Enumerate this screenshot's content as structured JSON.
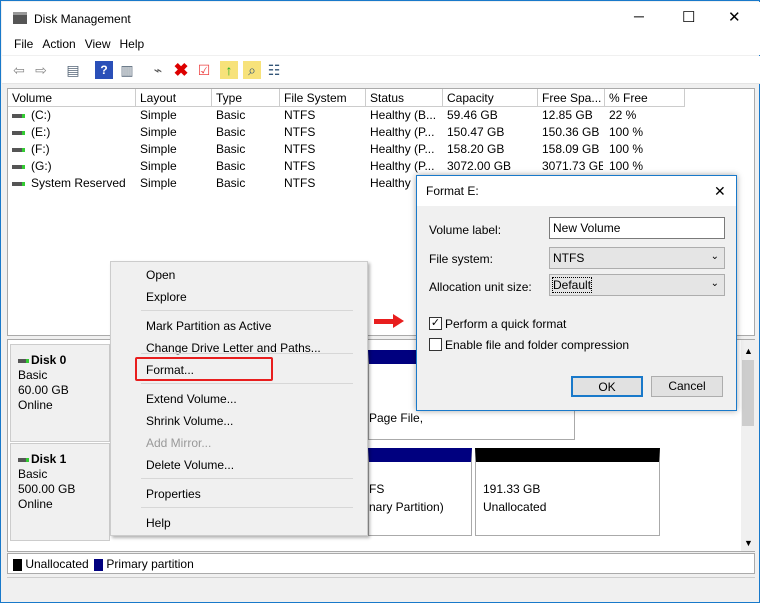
{
  "window": {
    "title": "Disk Management",
    "minimize": "─",
    "maximize": "☐",
    "close": "✕"
  },
  "menu": [
    "File",
    "Action",
    "View",
    "Help"
  ],
  "toolbar": [
    "back-icon",
    "forward-icon",
    "show-hide-console-tree-icon",
    "help-icon",
    "show-action-pane-icon",
    "connect-drive-icon",
    "delete-icon",
    "properties-icon",
    "up-folder-icon",
    "search-folder-icon",
    "checklist-icon"
  ],
  "columns": [
    "Volume",
    "Layout",
    "Type",
    "File System",
    "Status",
    "Capacity",
    "Free Spa...",
    "% Free"
  ],
  "volumes": [
    [
      "(C:)",
      "Simple",
      "Basic",
      "NTFS",
      "Healthy (B...",
      "59.46 GB",
      "12.85 GB",
      "22 %"
    ],
    [
      "(E:)",
      "Simple",
      "Basic",
      "NTFS",
      "Healthy (P...",
      "150.47 GB",
      "150.36 GB",
      "100 %"
    ],
    [
      "(F:)",
      "Simple",
      "Basic",
      "NTFS",
      "Healthy (P...",
      "158.20 GB",
      "158.09 GB",
      "100 %"
    ],
    [
      "(G:)",
      "Simple",
      "Basic",
      "NTFS",
      "Healthy (P...",
      "3072.00 GB",
      "3071.73 GB",
      "100 %"
    ],
    [
      "System Reserved",
      "Simple",
      "Basic",
      "NTFS",
      "Healthy",
      "",
      "",
      ""
    ]
  ],
  "disks": [
    {
      "name": "Disk 0",
      "type": "Basic",
      "size": "60.00 GB",
      "status": "Online",
      "partition_text": "Page File,"
    },
    {
      "name": "Disk 1",
      "type": "Basic",
      "size": "500.00 GB",
      "status": "Online",
      "partition_text1": "FS",
      "partition_text2": "nary Partition)",
      "unalloc_size": "191.33 GB",
      "unalloc_label": "Unallocated"
    }
  ],
  "legend": {
    "unallocated": "Unallocated",
    "primary": "Primary partition",
    "unallocated_color": "#000000",
    "primary_color": "#00007f"
  },
  "context_menu": {
    "items": [
      "Open",
      "Explore",
      "Mark Partition as Active",
      "Change Drive Letter and Paths...",
      "Format...",
      "Extend Volume...",
      "Shrink Volume...",
      "Add Mirror...",
      "Delete Volume...",
      "Properties",
      "Help"
    ],
    "highlighted": "Format...",
    "disabled": "Add Mirror..."
  },
  "dialog": {
    "title": "Format E:",
    "close": "✕",
    "volume_label_label": "Volume label:",
    "volume_label_value": "New Volume",
    "file_system_label": "File system:",
    "file_system_value": "NTFS",
    "alloc_label": "Allocation unit size:",
    "alloc_value": "Default",
    "quick_format": "Perform a quick format",
    "quick_format_checked": true,
    "compression": "Enable file and folder compression",
    "compression_checked": false,
    "ok": "OK",
    "cancel": "Cancel"
  },
  "accent": "#1979ca",
  "highlight_box_color": "#e81e1e"
}
